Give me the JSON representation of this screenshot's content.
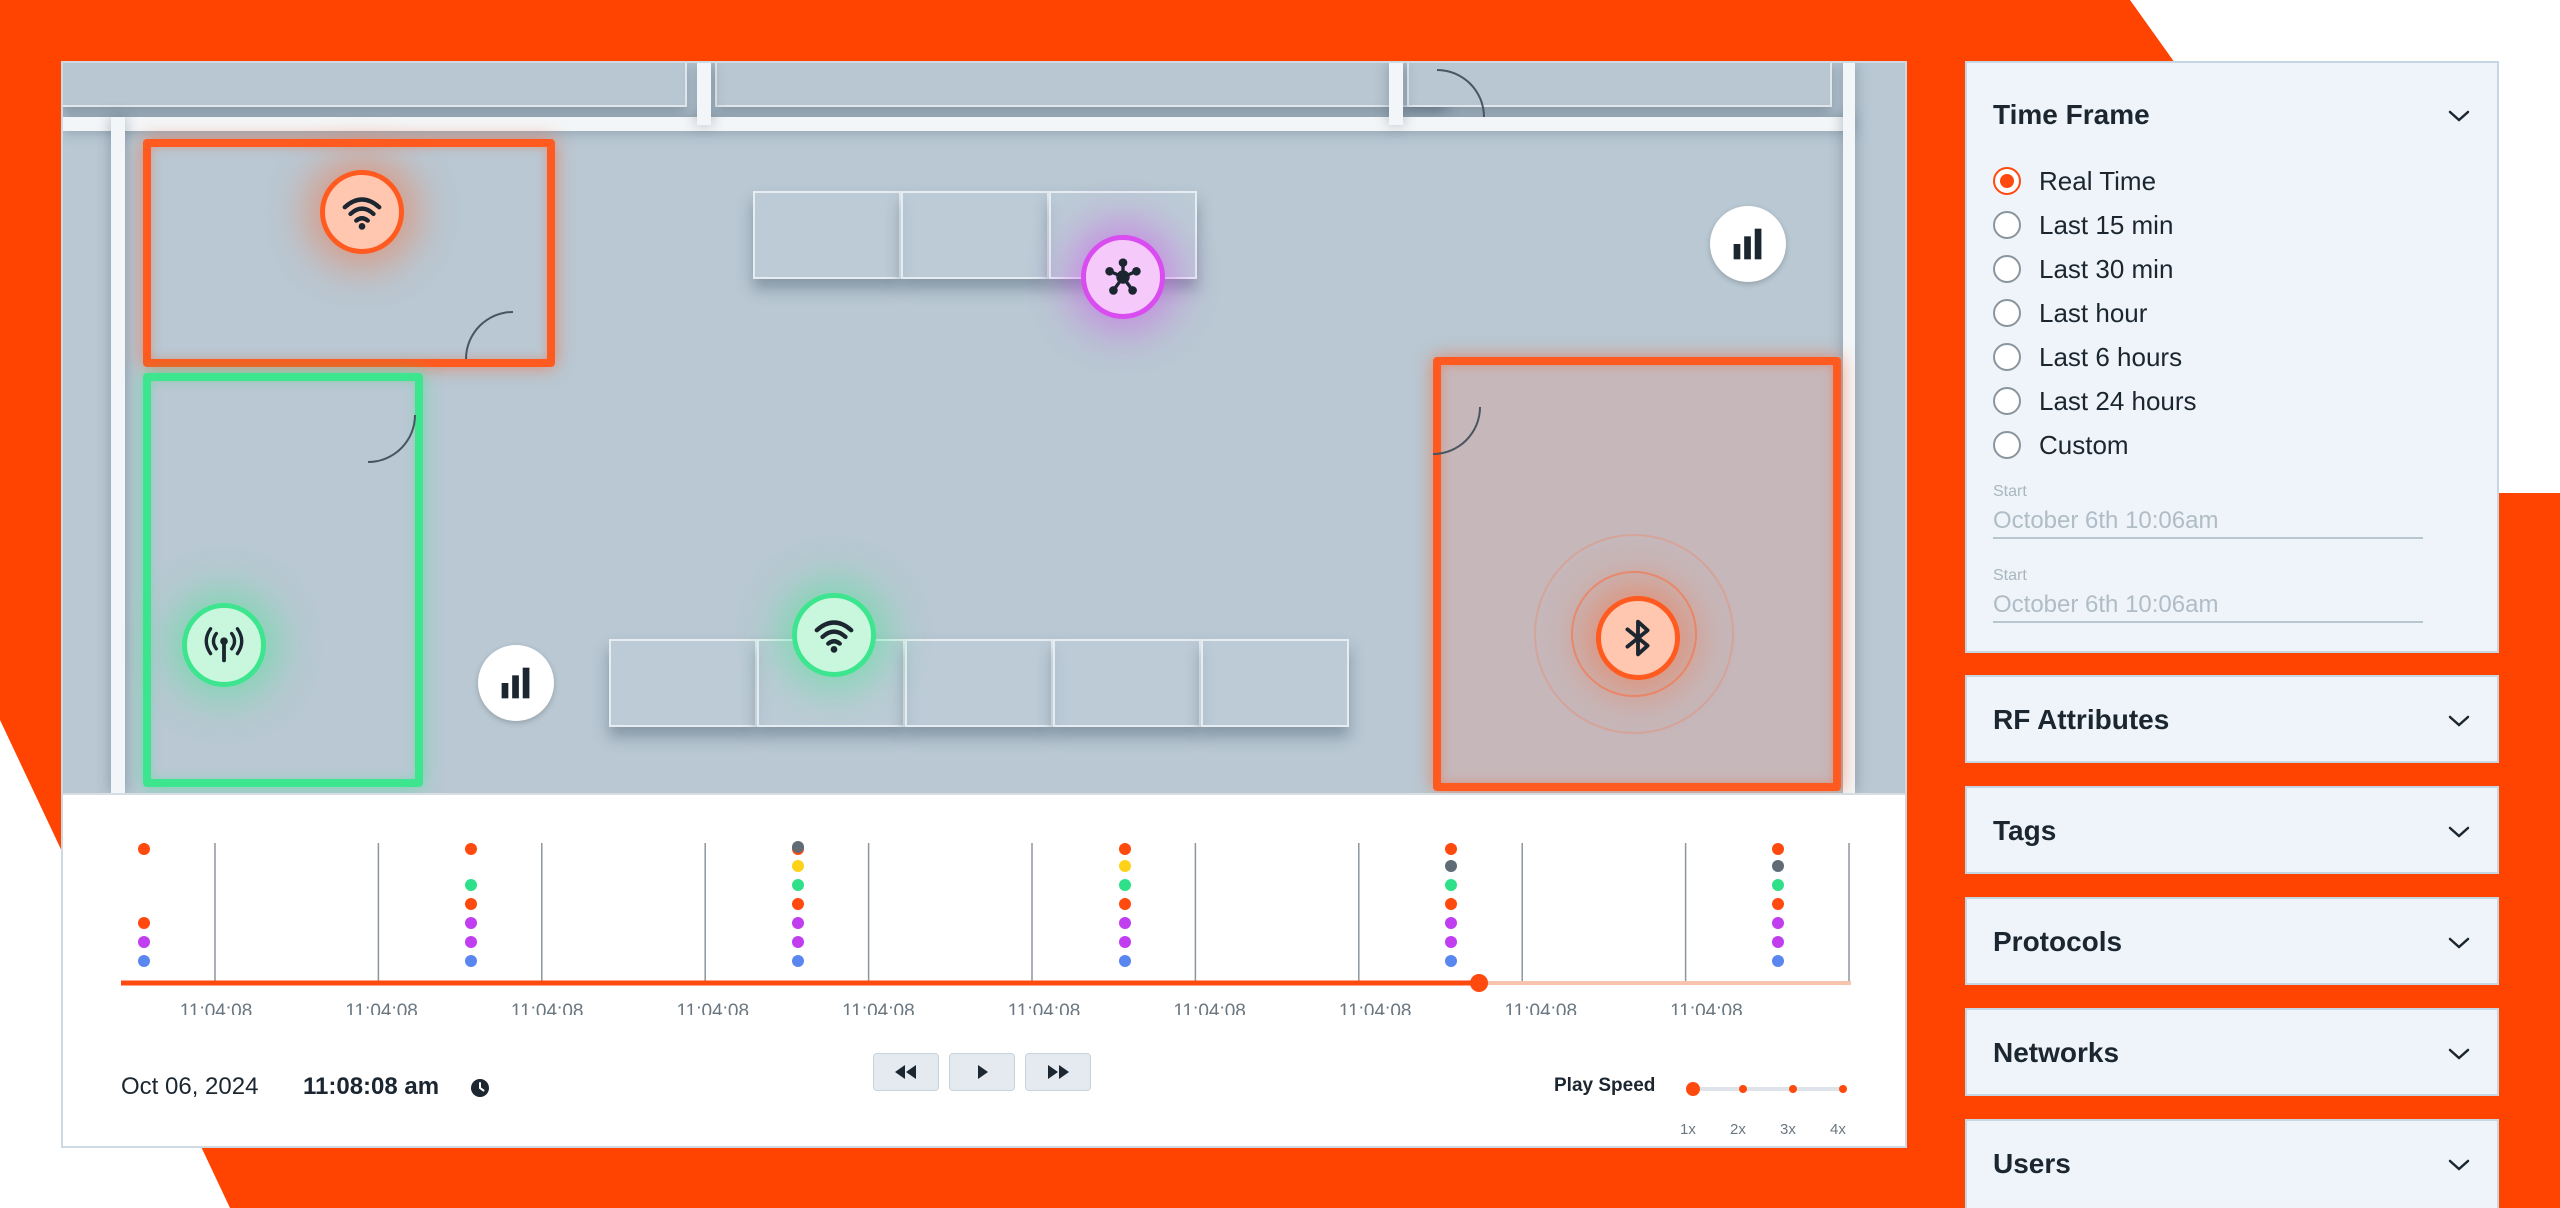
{
  "colors": {
    "accent": "#ff4a0f",
    "orange_zone": "#ff5a1f",
    "green_zone": "#3de58f",
    "purple_device": "#d94cf0",
    "dot_orange": "#ff4a0f",
    "dot_gray": "#5f6b75",
    "dot_yellow": "#ffd21a",
    "dot_green": "#2fe08a",
    "dot_purple": "#c03ef0",
    "dot_blue": "#5a86ef"
  },
  "map": {
    "markers": [
      {
        "name": "wifi-icon",
        "kind": "wifi",
        "tone": "orange"
      },
      {
        "name": "hub-icon",
        "kind": "hub",
        "tone": "purple"
      },
      {
        "name": "signal-bars-icon",
        "kind": "bars",
        "tone": "white"
      },
      {
        "name": "antenna-icon",
        "kind": "antenna",
        "tone": "green"
      },
      {
        "name": "wifi-icon",
        "kind": "wifi",
        "tone": "green"
      },
      {
        "name": "signal-bars-icon",
        "kind": "bars",
        "tone": "white"
      },
      {
        "name": "bluetooth-icon",
        "kind": "bluetooth",
        "tone": "orange"
      }
    ]
  },
  "timeline": {
    "tick_labels": [
      "11:04:08",
      "11:04:08",
      "11:04:08",
      "11:04:08",
      "11:04:08",
      "11:04:08",
      "11:04:08",
      "11:04:08",
      "11:04:08",
      "11:04:08"
    ],
    "progress": 0.785,
    "event_groups": [
      [
        "dot_orange",
        "dot_orange",
        "dot_purple",
        "dot_blue"
      ],
      [
        "dot_orange",
        "dot_green",
        "dot_orange",
        "dot_purple",
        "dot_purple",
        "dot_blue"
      ],
      [
        "dot_orange",
        "dot_gray",
        "dot_yellow",
        "dot_green",
        "dot_orange",
        "dot_purple",
        "dot_purple",
        "dot_blue"
      ],
      [
        "dot_orange",
        "dot_yellow",
        "dot_green",
        "dot_orange",
        "dot_purple",
        "dot_purple",
        "dot_blue"
      ],
      [
        "dot_orange",
        "dot_gray",
        "dot_green",
        "dot_orange",
        "dot_purple",
        "dot_purple",
        "dot_blue"
      ],
      [
        "dot_orange",
        "dot_gray",
        "dot_green",
        "dot_orange",
        "dot_purple",
        "dot_purple",
        "dot_blue"
      ]
    ],
    "date": "Oct 06, 2024",
    "time": "11:08:08 am",
    "controls": {
      "rewind_icon": "rewind-icon",
      "play_icon": "play-icon",
      "fast_forward_icon": "fast-forward-icon"
    },
    "play_speed": {
      "label": "Play Speed",
      "options": [
        "1x",
        "2x",
        "3x",
        "4x"
      ],
      "selected": "1x"
    }
  },
  "sidebar": {
    "time_frame": {
      "title": "Time Frame",
      "options": [
        "Real Time",
        "Last 15 min",
        "Last 30 min",
        "Last hour",
        "Last 6 hours",
        "Last 24 hours",
        "Custom"
      ],
      "selected_index": 0,
      "start_label_1": "Start",
      "start_value_1": "October 6th 10:06am",
      "start_label_2": "Start",
      "start_value_2": "October 6th 10:06am"
    },
    "sections": [
      {
        "title": "RF Attributes"
      },
      {
        "title": "Tags"
      },
      {
        "title": "Protocols"
      },
      {
        "title": "Networks"
      },
      {
        "title": "Users"
      }
    ]
  }
}
